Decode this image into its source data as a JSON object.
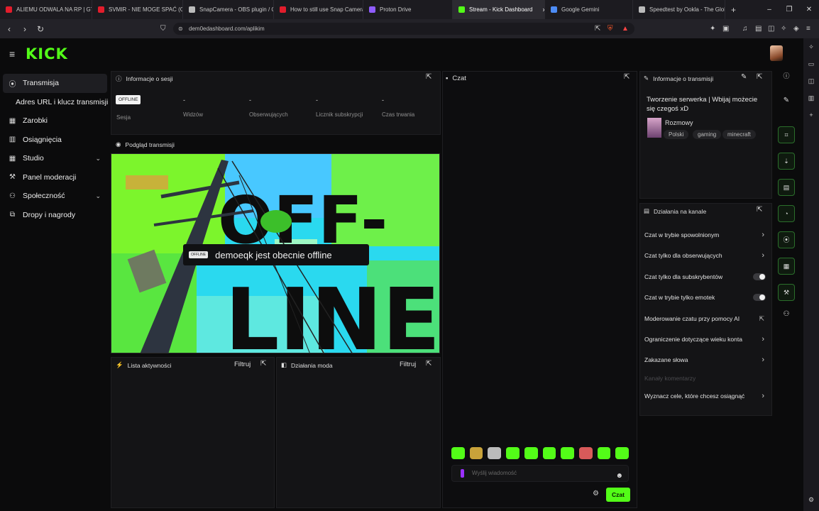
{
  "browser": {
    "tabs": [
      {
        "label": "ALIEMU ODWALA NA RP | GTA",
        "color": "#e21d2c"
      },
      {
        "label": "SVMIR - NIE MOGE SPAĆ (Offi",
        "color": "#e21d2c"
      },
      {
        "label": "SnapCamera - OBS plugin / Co",
        "color": "#bbbbbb"
      },
      {
        "label": "How to still use Snap Camera",
        "color": "#e21d2c"
      },
      {
        "label": "Proton Drive",
        "color": "#8f5cff"
      },
      {
        "label": "Stream - Kick Dashboard",
        "color": "#53fc18"
      },
      {
        "label": "Google Gemini",
        "color": "#4d8cf5"
      },
      {
        "label": "Speedtest by Ookla - The Glob",
        "color": "#bbbbbb"
      }
    ],
    "new_tab": "+",
    "url": "dem0edashboard.com/aplikim",
    "window_controls": {
      "minimize": "–",
      "maximize": "❐",
      "close": "✕"
    },
    "tab_close": "×"
  },
  "header": {
    "logo": "KICK",
    "menu_icon": "≡"
  },
  "sidebar": {
    "items": [
      {
        "label": "Transmisja",
        "icon": "broadcast-icon"
      },
      {
        "label": "Adres URL i klucz transmisji",
        "icon": ""
      },
      {
        "label": "Zarobki",
        "icon": "earnings-icon"
      },
      {
        "label": "Osiągnięcia",
        "icon": "achievements-icon"
      },
      {
        "label": "Studio",
        "icon": "studio-icon"
      },
      {
        "label": "Panel moderacji",
        "icon": "moderation-icon"
      },
      {
        "label": "Społeczność",
        "icon": "community-icon"
      },
      {
        "label": "Dropy i nagrody",
        "icon": "drops-icon"
      }
    ]
  },
  "session": {
    "title": "Informacje o sesji",
    "badge": "OFFLINE",
    "stats": [
      {
        "value": "",
        "label": "Sesja"
      },
      {
        "value": "-",
        "label": "Widzów"
      },
      {
        "value": "-",
        "label": "Obserwujących"
      },
      {
        "value": "-",
        "label": "Licznik subskrypcji"
      },
      {
        "value": "-",
        "label": "Czas trwania"
      }
    ]
  },
  "preview": {
    "title": "Podgląd transmisji",
    "big_text_1": "OFF-",
    "big_text_2": "LINE",
    "mini_badge": "OFFLINE",
    "message": "demoeqk jest obecnie offline"
  },
  "activity": {
    "title": "Lista aktywności",
    "filter": "Filtruj"
  },
  "mod_actions": {
    "title": "Działania moda",
    "filter": "Filtruj"
  },
  "chat": {
    "title": "Czat",
    "input_placeholder": "Wyślij wiadomość",
    "send_label": "Czat",
    "emotes": [
      "#53fc18",
      "#c8a23a",
      "#bbbbbb",
      "#53fc18",
      "#53fc18",
      "#53fc18",
      "#53fc18",
      "#d85a5a",
      "#53fc18",
      "#53fc18"
    ]
  },
  "stream_info": {
    "title": "Informacje o transmisji",
    "stream_title": "Tworzenie serwerka | Wbijaj możecie się czegoś xD",
    "category": "Rozmowy",
    "tags": [
      "Polski",
      "gaming",
      "minecraft"
    ]
  },
  "channel_actions": {
    "title": "Działania na kanale",
    "rows": [
      {
        "label": "Czat w trybie spowolnionym",
        "control": "chevron"
      },
      {
        "label": "Czat tylko dla obserwujących",
        "control": "chevron"
      },
      {
        "label": "Czat tylko dla subskrybentów",
        "control": "toggle"
      },
      {
        "label": "Czat w trybie tylko emotek",
        "control": "toggle"
      },
      {
        "label": "Moderowanie czatu przy pomocy AI",
        "control": "external"
      },
      {
        "label": "Ograniczenie dotyczące wieku konta",
        "control": "chevron"
      },
      {
        "label": "Zakazane słowa",
        "control": "chevron"
      },
      {
        "label": "Kanały komentarzy",
        "control": "none"
      },
      {
        "label": "Wyznacz cele, które chcesz osiągnąć",
        "control": "chevron"
      }
    ]
  },
  "colors": {
    "accent": "#53fc18",
    "panel": "#141416",
    "bg": "#0b0b0c"
  }
}
